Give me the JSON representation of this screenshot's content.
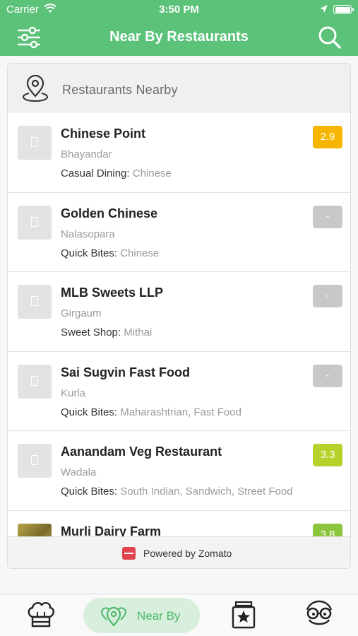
{
  "status_bar": {
    "carrier": "Carrier",
    "time": "3:50 PM"
  },
  "nav": {
    "title": "Near By Restaurants",
    "left_icon": "filter-icon",
    "right_icon": "search-icon"
  },
  "section": {
    "label": "Restaurants Nearby",
    "icon": "map-pin-icon"
  },
  "restaurants": [
    {
      "name": "Chinese Point",
      "area": "Bhayandar",
      "type": "Casual Dining:",
      "cuisines": "Chinese",
      "rating": "2.9",
      "rating_color": "#f7b500",
      "thumb": "placeholder"
    },
    {
      "name": "Golden Chinese",
      "area": "Nalasopara",
      "type": "Quick Bites:",
      "cuisines": "Chinese",
      "rating": "-",
      "rating_color": "#c8c8c8",
      "thumb": "placeholder"
    },
    {
      "name": "MLB Sweets LLP",
      "area": "Girgaum",
      "type": "Sweet Shop:",
      "cuisines": "Mithai",
      "rating": "-",
      "rating_color": "#c8c8c8",
      "thumb": "placeholder"
    },
    {
      "name": "Sai Sugvin Fast Food",
      "area": "Kurla",
      "type": "Quick Bites:",
      "cuisines": "Maharashtrian, Fast Food",
      "rating": "-",
      "rating_color": "#c8c8c8",
      "thumb": "placeholder"
    },
    {
      "name": "Aanandam Veg Restaurant",
      "area": "Wadala",
      "type": "Quick Bites:",
      "cuisines": "South Indian, Sandwich, Street Food",
      "rating": "3.3",
      "rating_color": "#b7d12b",
      "thumb": "placeholder"
    },
    {
      "name": "Murli Dairy Farm",
      "area": "",
      "type": "",
      "cuisines": "",
      "rating": "3.8",
      "rating_color": "#8cc63f",
      "thumb": "photo"
    }
  ],
  "footer": {
    "text": "Powered by Zomato"
  },
  "tabs": [
    {
      "icon": "chef-hat-icon",
      "label": ""
    },
    {
      "icon": "location-cluster-icon",
      "label": "Near By",
      "active": true
    },
    {
      "icon": "star-jar-icon",
      "label": ""
    },
    {
      "icon": "glasses-face-icon",
      "label": ""
    }
  ],
  "colors": {
    "brand_green": "#5cc27a",
    "active_tab_bg": "#d8efde",
    "active_tab_text": "#4bb96a"
  }
}
